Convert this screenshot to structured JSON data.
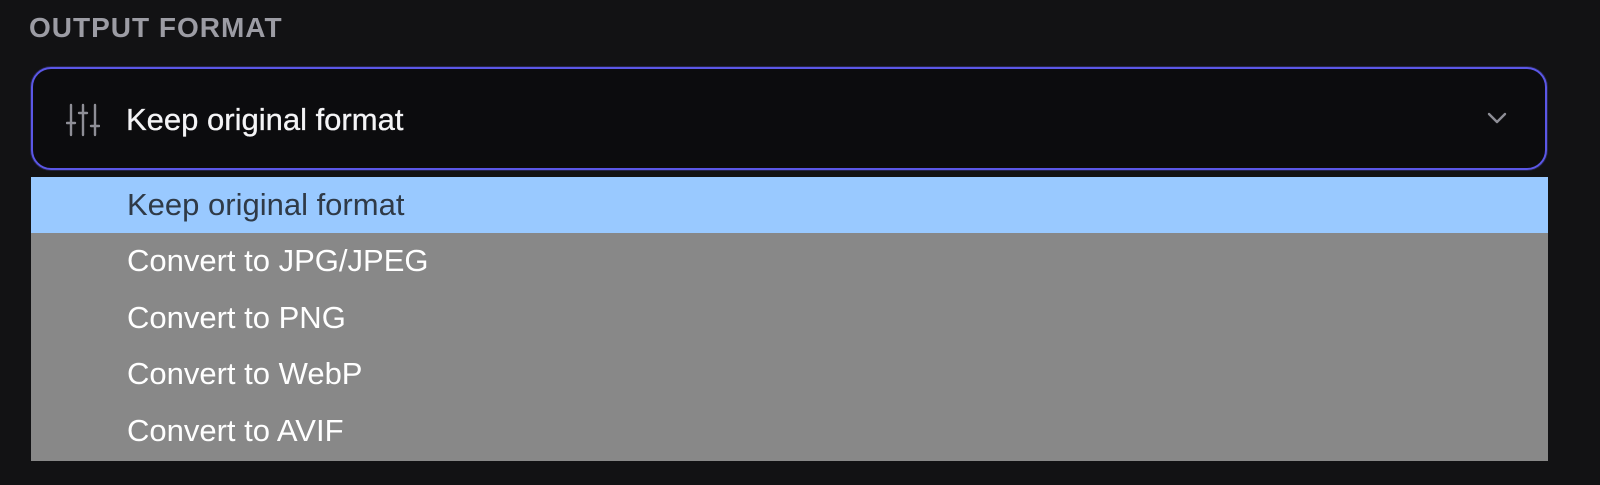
{
  "section": {
    "label": "OUTPUT FORMAT"
  },
  "select": {
    "icon": "sliders-icon",
    "selected_label": "Keep original format",
    "chevron_icon": "chevron-down-icon",
    "border_color": "#5b57e6",
    "highlight_color": "#99c9ff",
    "options": [
      {
        "label": "Keep original format",
        "highlighted": true
      },
      {
        "label": "Convert to JPG/JPEG",
        "highlighted": false
      },
      {
        "label": "Convert to PNG",
        "highlighted": false
      },
      {
        "label": "Convert to WebP",
        "highlighted": false
      },
      {
        "label": "Convert to AVIF",
        "highlighted": false
      }
    ]
  }
}
